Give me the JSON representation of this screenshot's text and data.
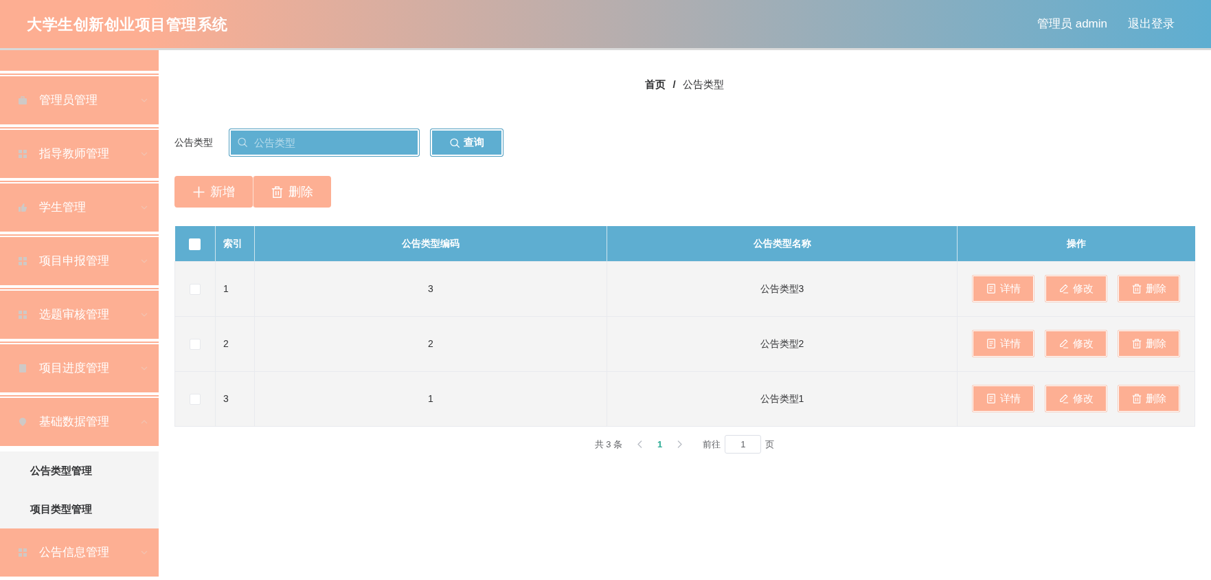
{
  "header": {
    "title": "大学生创新创业项目管理系统",
    "user": "管理员 admin",
    "logout": "退出登录"
  },
  "sidebar": {
    "items": [
      {
        "label": "管理员管理",
        "expanded": false
      },
      {
        "label": "指导教师管理",
        "expanded": false
      },
      {
        "label": "学生管理",
        "expanded": false
      },
      {
        "label": "项目申报管理",
        "expanded": false
      },
      {
        "label": "选题审核管理",
        "expanded": false
      },
      {
        "label": "项目进度管理",
        "expanded": false
      },
      {
        "label": "基础数据管理",
        "expanded": true,
        "children": [
          {
            "label": "公告类型管理"
          },
          {
            "label": "项目类型管理"
          }
        ]
      },
      {
        "label": "公告信息管理",
        "expanded": false
      }
    ]
  },
  "breadcrumb": {
    "items": [
      "首页",
      "公告类型"
    ],
    "separator": "/"
  },
  "search": {
    "label": "公告类型",
    "placeholder": "公告类型",
    "button": "查询"
  },
  "toolbar": {
    "buttons": [
      {
        "kind": "add",
        "label": "新增"
      },
      {
        "kind": "delete",
        "label": "删除"
      }
    ]
  },
  "table": {
    "select_all": {
      "checked": false
    },
    "columns": [
      "索引",
      "公告类型编码",
      "公告类型名称",
      "操作"
    ],
    "rows": [
      {
        "checked": false,
        "cells": [
          "1",
          "3",
          "公告类型3"
        ],
        "actions": [
          {
            "kind": "detail",
            "label": "详情"
          },
          {
            "kind": "edit",
            "label": "修改"
          },
          {
            "kind": "delete",
            "label": "删除"
          }
        ]
      },
      {
        "checked": false,
        "cells": [
          "2",
          "2",
          "公告类型2"
        ],
        "actions": [
          {
            "kind": "detail",
            "label": "详情"
          },
          {
            "kind": "edit",
            "label": "修改"
          },
          {
            "kind": "delete",
            "label": "删除"
          }
        ]
      },
      {
        "checked": false,
        "cells": [
          "3",
          "1",
          "公告类型1"
        ],
        "actions": [
          {
            "kind": "detail",
            "label": "详情"
          },
          {
            "kind": "edit",
            "label": "修改"
          },
          {
            "kind": "delete",
            "label": "删除"
          }
        ]
      }
    ]
  },
  "pagination": {
    "total": "共 3 条",
    "pages": [
      {
        "label": "1",
        "selected": true
      }
    ],
    "goto_label": "前往",
    "goto_value": "1",
    "page_suffix": "页"
  }
}
